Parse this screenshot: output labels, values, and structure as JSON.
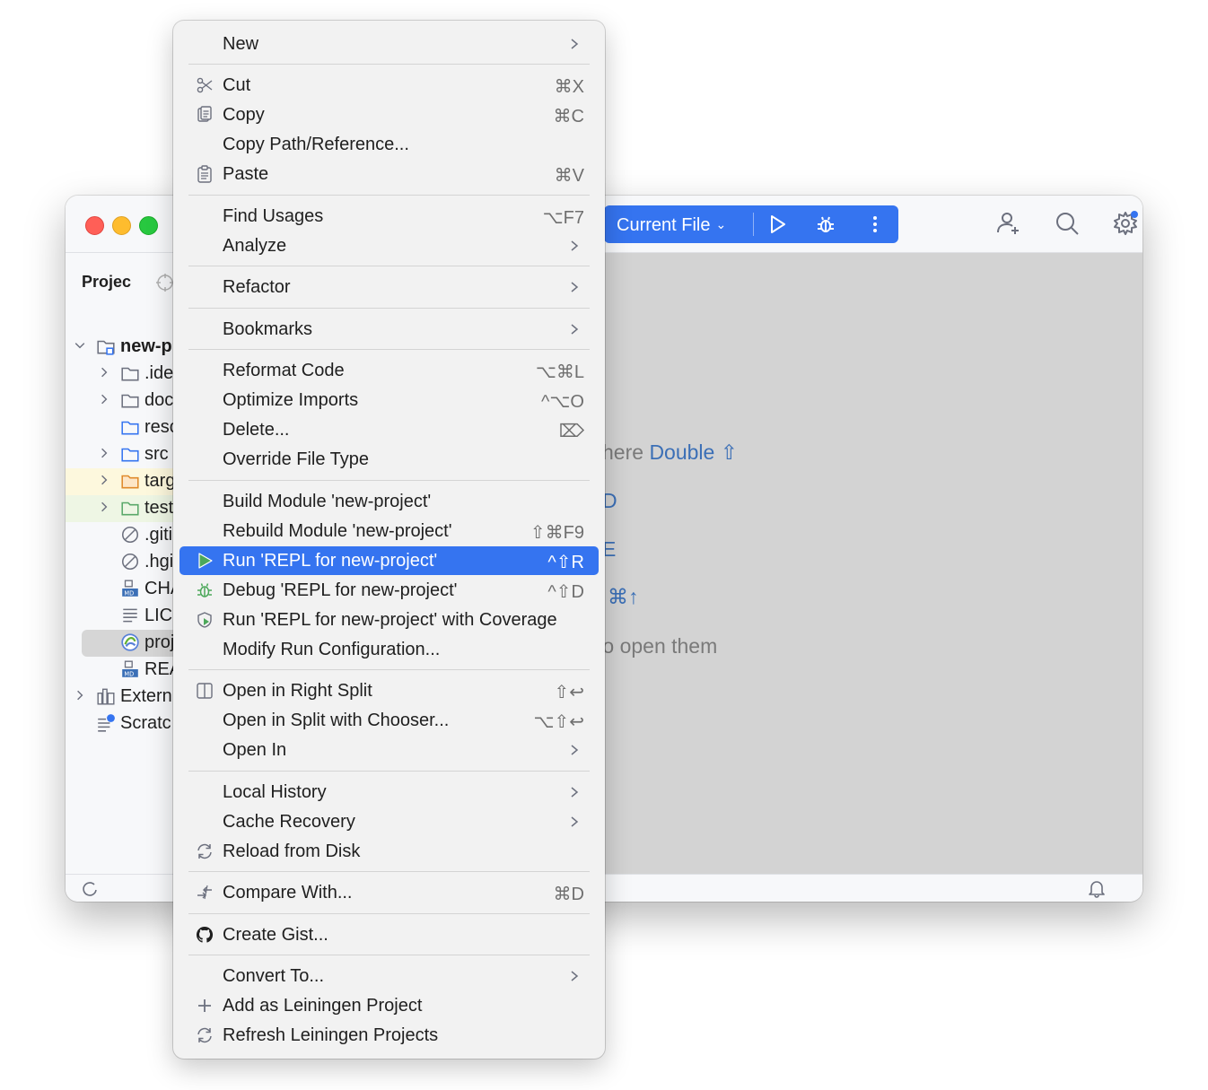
{
  "toolbar": {
    "run_config_label": "Current File"
  },
  "project_panel": {
    "title": "Projec",
    "tree": [
      {
        "label": "new-p",
        "bold": true
      },
      {
        "label": ".ide"
      },
      {
        "label": "doc"
      },
      {
        "label": "resc"
      },
      {
        "label": "src"
      },
      {
        "label": "targ"
      },
      {
        "label": "test"
      },
      {
        "label": ".giti"
      },
      {
        "label": ".hgi"
      },
      {
        "label": "CHA"
      },
      {
        "label": "LIC"
      },
      {
        "label": "proj"
      },
      {
        "label": "REA"
      },
      {
        "label": "Extern"
      },
      {
        "label": "Scratc"
      }
    ]
  },
  "editor_hints": {
    "line1_text": "here ",
    "line1_key": "Double ⇧",
    "line2_key": "D",
    "line3_key": "E",
    "line4_key": "⌘↑",
    "line5_text": " to open them"
  },
  "menu": {
    "items": [
      {
        "label": "New",
        "shortcut": "",
        "submenu": true
      },
      {
        "label": "Cut",
        "shortcut": "⌘X",
        "icon": "scissors-icon"
      },
      {
        "label": "Copy",
        "shortcut": "⌘C",
        "icon": "copy-icon"
      },
      {
        "label": "Copy Path/Reference...",
        "shortcut": ""
      },
      {
        "label": "Paste",
        "shortcut": "⌘V",
        "icon": "paste-icon"
      },
      {
        "label": "Find Usages",
        "shortcut": "⌥F7"
      },
      {
        "label": "Analyze",
        "shortcut": "",
        "submenu": true
      },
      {
        "label": "Refactor",
        "shortcut": "",
        "submenu": true
      },
      {
        "label": "Bookmarks",
        "shortcut": "",
        "submenu": true
      },
      {
        "label": "Reformat Code",
        "shortcut": "⌥⌘L"
      },
      {
        "label": "Optimize Imports",
        "shortcut": "^⌥O"
      },
      {
        "label": "Delete...",
        "shortcut": "⌦"
      },
      {
        "label": "Override File Type",
        "shortcut": ""
      },
      {
        "label": "Build Module 'new-project'",
        "shortcut": ""
      },
      {
        "label": "Rebuild Module 'new-project'",
        "shortcut": "⇧⌘F9"
      },
      {
        "label": "Run 'REPL for new-project'",
        "shortcut": "^⇧R",
        "icon": "run-icon",
        "selected": true
      },
      {
        "label": "Debug 'REPL for new-project'",
        "shortcut": "^⇧D",
        "icon": "debug-icon"
      },
      {
        "label": "Run 'REPL for new-project' with Coverage",
        "shortcut": "",
        "icon": "coverage-icon"
      },
      {
        "label": "Modify Run Configuration...",
        "shortcut": ""
      },
      {
        "label": "Open in Right Split",
        "shortcut": "⇧↩",
        "icon": "split-icon"
      },
      {
        "label": "Open in Split with Chooser...",
        "shortcut": "⌥⇧↩"
      },
      {
        "label": "Open In",
        "shortcut": "",
        "submenu": true
      },
      {
        "label": "Local History",
        "shortcut": "",
        "submenu": true
      },
      {
        "label": "Cache Recovery",
        "shortcut": "",
        "submenu": true
      },
      {
        "label": "Reload from Disk",
        "shortcut": "",
        "icon": "reload-icon"
      },
      {
        "label": "Compare With...",
        "shortcut": "⌘D",
        "icon": "compare-icon"
      },
      {
        "label": "Create Gist...",
        "shortcut": "",
        "icon": "github-icon"
      },
      {
        "label": "Convert To...",
        "shortcut": "",
        "submenu": true
      },
      {
        "label": "Add as Leiningen Project",
        "shortcut": "",
        "icon": "plus-icon"
      },
      {
        "label": "Refresh Leiningen Projects",
        "shortcut": "",
        "icon": "refresh-icon"
      }
    ]
  },
  "colors": {
    "accent": "#3574f0",
    "menu_background": "#f2f2f2",
    "editor_background": "#d3d3d3",
    "hint_key": "#3b6fb6"
  }
}
